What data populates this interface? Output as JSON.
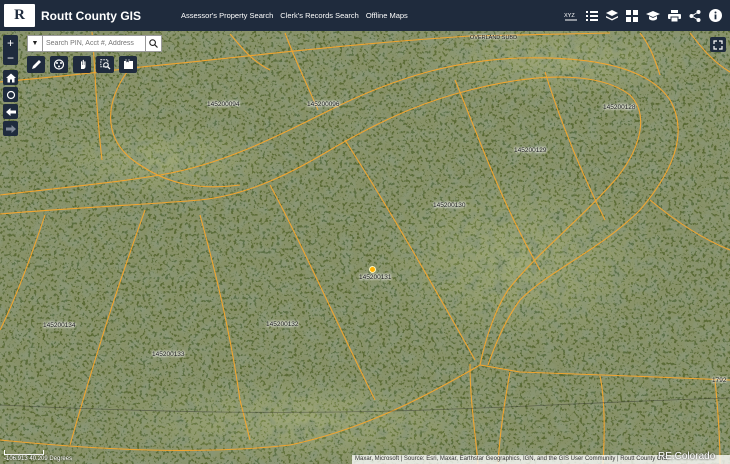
{
  "header": {
    "logo_text": "R",
    "title": "Routt County GIS",
    "nav": [
      {
        "label": "Assessor's Property Search"
      },
      {
        "label": "Clerk's Records Search"
      },
      {
        "label": "Offline Maps"
      }
    ],
    "tool_icons": [
      "xyz-icon",
      "list-icon",
      "layers-icon",
      "basemap-icon",
      "education-icon",
      "print-icon",
      "share-icon",
      "info-icon"
    ]
  },
  "search": {
    "placeholder": "Search PIN, Acct #, Address"
  },
  "map": {
    "subdivision_label": "OVERLAND SUBD",
    "parcels": {
      "p094": "145200094",
      "p096": "145200096",
      "p128": "145200128",
      "p129": "145200129",
      "p130": "145200130",
      "p131": "145200131",
      "p132": "145200132",
      "p133": "145200133",
      "p134": "145200134",
      "p179": "1792"
    },
    "coordinates": "-106.913 40.209 Degrees",
    "attribution": "Maxar, Microsoft | Source: Esri, Maxar, Earthstar Geographics, IGN, and the GIS User Community | Routt County GIS",
    "watermark": "RE.Colorado",
    "colors": {
      "parcel_line": "#f0a530",
      "toolbar": "#1f2b3d",
      "marker": "#ffb200"
    }
  }
}
